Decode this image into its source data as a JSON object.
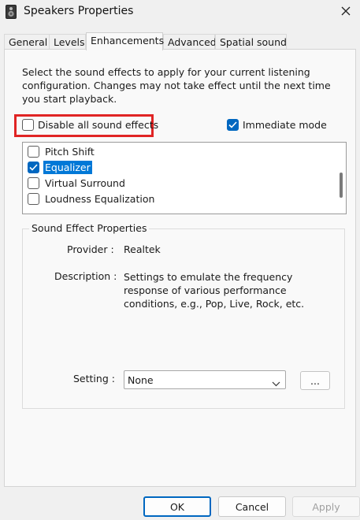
{
  "window": {
    "title": "Speakers Properties"
  },
  "tabs": [
    {
      "label": "General"
    },
    {
      "label": "Levels"
    },
    {
      "label": "Enhancements"
    },
    {
      "label": "Advanced"
    },
    {
      "label": "Spatial sound"
    }
  ],
  "enhancements": {
    "intro": "Select the sound effects to apply for your current listening configuration. Changes may not take effect until the next time you start playback.",
    "disable_all_label": "Disable all sound effects",
    "immediate_mode_label": "Immediate mode",
    "effects": [
      {
        "label": "Pitch Shift",
        "checked": false
      },
      {
        "label": "Equalizer",
        "checked": true
      },
      {
        "label": "Virtual Surround",
        "checked": false
      },
      {
        "label": "Loudness Equalization",
        "checked": false
      }
    ]
  },
  "properties": {
    "group_title": "Sound Effect Properties",
    "provider_label": "Provider :",
    "provider_value": "Realtek",
    "description_label": "Description :",
    "description_value": "Settings to emulate the frequency response of various performance conditions,  e.g., Pop, Live, Rock, etc.",
    "setting_label": "Setting :",
    "setting_value": "None",
    "more_label": "..."
  },
  "buttons": {
    "ok": "OK",
    "cancel": "Cancel",
    "apply": "Apply"
  },
  "colors": {
    "accent": "#0067c0",
    "highlight_border": "#e02424"
  }
}
